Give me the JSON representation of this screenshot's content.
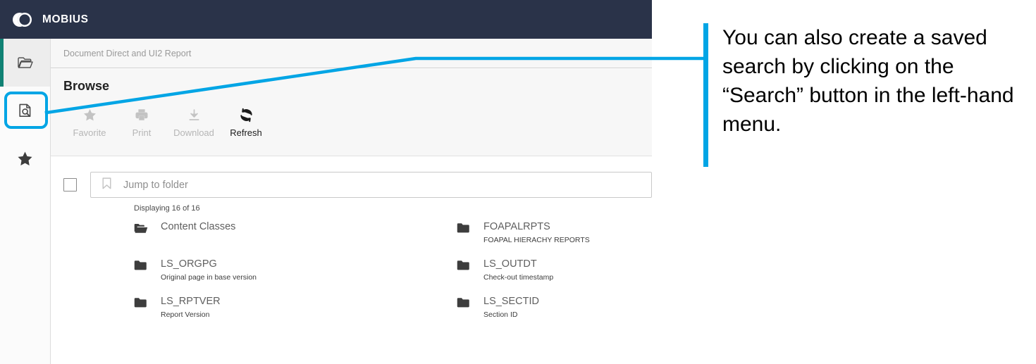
{
  "app": {
    "brand_title": "MOBIUS",
    "logo_icon": "mobius-circles-logo"
  },
  "sidebar": {
    "items": [
      {
        "name": "browse",
        "icon": "folder-open-icon",
        "active": true
      },
      {
        "name": "search",
        "icon": "document-search-icon",
        "active": false
      },
      {
        "name": "favorites",
        "icon": "star-icon",
        "active": false
      }
    ]
  },
  "breadcrumb": {
    "text": "Document Direct and UI2 Report"
  },
  "page": {
    "title": "Browse"
  },
  "toolbar": {
    "buttons": [
      {
        "label": "Favorite",
        "icon": "star-icon",
        "enabled": false
      },
      {
        "label": "Print",
        "icon": "printer-icon",
        "enabled": false
      },
      {
        "label": "Download",
        "icon": "download-icon",
        "enabled": false
      },
      {
        "label": "Refresh",
        "icon": "refresh-icon",
        "enabled": true
      }
    ]
  },
  "list": {
    "jump_placeholder": "Jump to folder",
    "jump_icon": "bookmark-icon",
    "select_all_checked": false,
    "displaying": "Displaying 16 of 16",
    "folders": [
      {
        "name": "Content Classes",
        "desc": "",
        "icon": "folder-open-icon"
      },
      {
        "name": "FOAPALRPTS",
        "desc": "FOAPAL HIERACHY REPORTS",
        "icon": "folder-icon"
      },
      {
        "name": "LS_ORGPG",
        "desc": "Original page in base version",
        "icon": "folder-icon"
      },
      {
        "name": "LS_OUTDT",
        "desc": "Check-out timestamp",
        "icon": "folder-icon"
      },
      {
        "name": "LS_RPTVER",
        "desc": "Report Version",
        "icon": "folder-icon"
      },
      {
        "name": "LS_SECTID",
        "desc": "Section ID",
        "icon": "folder-icon"
      }
    ]
  },
  "annotation": {
    "text": "You can also create a saved search by clicking on the “Search” button in the left-hand menu.",
    "accent_color": "#00a5e5"
  },
  "colors": {
    "header_bg": "#2a3349",
    "rail_bg": "#fbfbfb",
    "rail_active_bg": "#ededed",
    "rail_active_marker": "#108274",
    "panel_bg": "#f7f7f7",
    "callout": "#00a5e5",
    "folder_name": "#5f5f5f"
  }
}
